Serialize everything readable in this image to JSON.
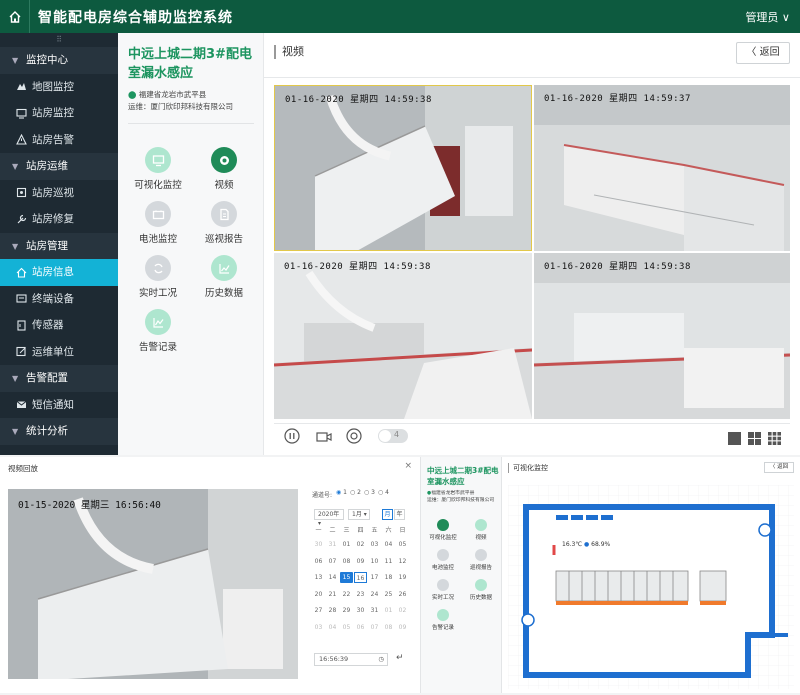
{
  "app": {
    "title": "智能配电房综合辅助监控系统",
    "user": "管理员 ∨"
  },
  "sidebar": {
    "handle": "⠿",
    "sections": [
      {
        "label": "监控中心",
        "items": [
          "地图监控",
          "站房监控",
          "站房告警"
        ]
      },
      {
        "label": "站房运维",
        "items": [
          "站房巡视",
          "站房修复"
        ]
      },
      {
        "label": "站房管理",
        "items": [
          "站房信息",
          "终端设备",
          "传感器",
          "运维单位"
        ]
      },
      {
        "label": "告警配置",
        "items": [
          "短信通知"
        ]
      },
      {
        "label": "统计分析",
        "items": []
      }
    ],
    "active_item": "站房信息"
  },
  "station": {
    "title": "中远上城二期3#配电室漏水感应",
    "location": "福建省龙岩市武平县",
    "operator": "运维：厦门欣印邦科技有限公司"
  },
  "functions": [
    "可视化监控",
    "视频",
    "电池监控",
    "巡视报告",
    "实时工况",
    "历史数据",
    "告警记录"
  ],
  "video": {
    "header": "视频",
    "back_label": "〈  返回",
    "cameras": [
      {
        "timestamp": "01-16-2020 星期四 14:59:38"
      },
      {
        "timestamp": "01-16-2020 星期四 14:59:37"
      },
      {
        "timestamp": "01-16-2020 星期四 14:59:38"
      },
      {
        "timestamp": "01-16-2020 星期四 14:59:38"
      }
    ],
    "toolbar": {
      "toggle_value": "4"
    }
  },
  "playback": {
    "title": "视频回放",
    "close": "×",
    "timestamp": "01-15-2020 星期三 16:56:40",
    "channel_label": "通道号:",
    "channels": [
      "1",
      "2",
      "3",
      "4"
    ],
    "year": "2020年",
    "month": "1月",
    "view_month": "月",
    "view_year": "年",
    "weekdays": [
      "一",
      "二",
      "三",
      "四",
      "五",
      "六",
      "日"
    ],
    "days": [
      "30",
      "31",
      "01",
      "02",
      "03",
      "04",
      "05",
      "06",
      "07",
      "08",
      "09",
      "10",
      "11",
      "12",
      "13",
      "14",
      "15",
      "16",
      "17",
      "18",
      "19",
      "20",
      "21",
      "22",
      "23",
      "24",
      "25",
      "26",
      "27",
      "28",
      "29",
      "30",
      "31",
      "01",
      "02",
      "03",
      "04",
      "05",
      "06",
      "07",
      "08",
      "09"
    ],
    "dim_days": [
      0,
      1,
      33,
      34,
      35,
      36,
      37,
      38,
      39,
      40,
      41
    ],
    "selected_index": 16,
    "today_index": 17,
    "time_value": "16:56:39"
  },
  "mini": {
    "title": "中远上城二期3#配电室漏水感应",
    "location": "福建省龙岩市武平县",
    "operator": "运维：厦门欣印邦科技有限公司"
  },
  "visual": {
    "header": "可视化监控",
    "back_label": "〈 返回",
    "temperature": "16.3℃",
    "humidity": "68.9%"
  },
  "colors": {
    "brand": "#0d5a3f",
    "accent": "#13b2d6",
    "station_title": "#1d9560",
    "room_wall": "#1e6fd0"
  }
}
